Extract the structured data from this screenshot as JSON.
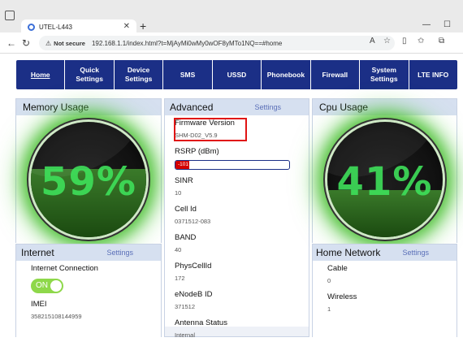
{
  "browser": {
    "tab_title": "UTEL-L443",
    "not_secure": "Not secure",
    "url": "192.168.1.1/index.html?t=MjAyMi0wMy0wOF8yMTo1NQ==#home"
  },
  "nav": {
    "items": [
      {
        "label": "Home"
      },
      {
        "label": "Quick Settings"
      },
      {
        "label": "Device Settings"
      },
      {
        "label": "SMS"
      },
      {
        "label": "USSD"
      },
      {
        "label": "Phonebook"
      },
      {
        "label": "Firewall"
      },
      {
        "label": "System Settings"
      },
      {
        "label": "LTE INFO"
      }
    ]
  },
  "memory": {
    "title": "Memory Usage",
    "percent_label": "59%",
    "percent": 59
  },
  "cpu": {
    "title": "Cpu Usage",
    "percent_label": "41%",
    "percent": 41
  },
  "advanced": {
    "title": "Advanced",
    "settings": "Settings",
    "firmware_label": "Firmware Version",
    "firmware_value": "SHM-D02_V5.9",
    "rsrp_label": "RSRP (dBm)",
    "rsrp_value": "-101",
    "sinr_label": "SINR",
    "sinr_value": "10",
    "cellid_label": "Cell Id",
    "cellid_value": "0371512-083",
    "band_label": "BAND",
    "band_value": "40",
    "physcell_label": "PhysCellId",
    "physcell_value": "172",
    "enodeb_label": "eNodeB ID",
    "enodeb_value": "371512",
    "antenna_label": "Antenna Status",
    "antenna_value": "Internal"
  },
  "internet": {
    "title": "Internet",
    "settings": "Settings",
    "connection_label": "Internet Connection",
    "toggle_label": "ON",
    "imei_label": "IMEI",
    "imei_value": "358215108144959"
  },
  "home_network": {
    "title": "Home Network",
    "settings": "Settings",
    "cable_label": "Cable",
    "cable_value": "0",
    "wireless_label": "Wireless",
    "wireless_value": "1"
  }
}
